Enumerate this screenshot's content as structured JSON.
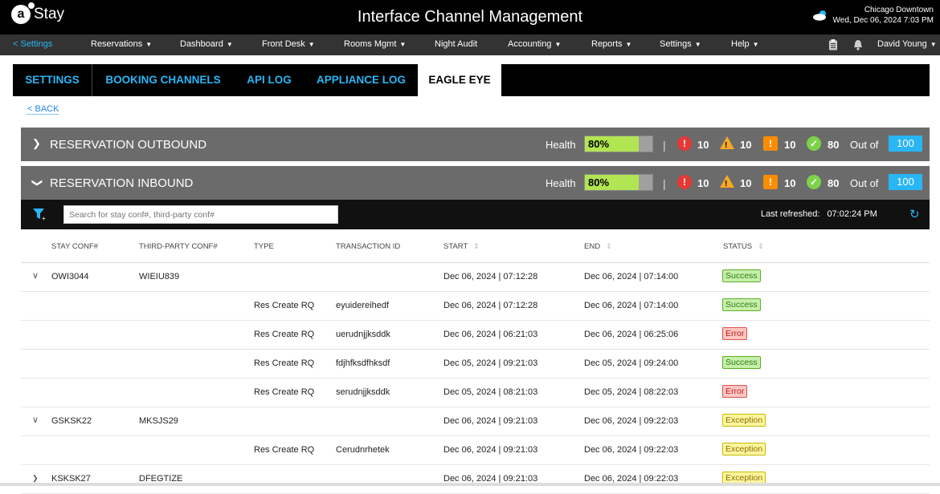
{
  "header": {
    "logo_letter": "a",
    "logo_text": "Stay",
    "title": "Interface Channel Management",
    "location": "Chicago Downtown",
    "datetime": "Wed, Dec 06, 2024 7:03 PM",
    "weather_icon": "cloud-icon"
  },
  "menu": {
    "back": "< Settings",
    "items": [
      {
        "label": "Reservations",
        "dropdown": true
      },
      {
        "label": "Dashboard",
        "dropdown": true
      },
      {
        "label": "Front Desk",
        "dropdown": true
      },
      {
        "label": "Rooms Mgmt",
        "dropdown": true
      },
      {
        "label": "Night Audit",
        "dropdown": false
      },
      {
        "label": "Accounting",
        "dropdown": true
      },
      {
        "label": "Reports",
        "dropdown": true
      },
      {
        "label": "Settings",
        "dropdown": true
      },
      {
        "label": "Help",
        "dropdown": true
      }
    ],
    "user": "David Young"
  },
  "tabs": [
    "SETTINGS",
    "BOOKING CHANNELS",
    "API LOG",
    "APPLIANCE LOG",
    "EAGLE EYE"
  ],
  "active_tab": "EAGLE EYE",
  "back_link": "< BACK",
  "sections": [
    {
      "title": "RESERVATION OUTBOUND",
      "expanded": false,
      "health_label": "Health",
      "health": "80%",
      "health_value": 0.8,
      "errors": "10",
      "warnings": "10",
      "alerts": "10",
      "success": "80",
      "out_of_label": "Out of",
      "total": "100"
    },
    {
      "title": "RESERVATION INBOUND",
      "expanded": true,
      "health_label": "Health",
      "health": "80%",
      "health_value": 0.8,
      "errors": "10",
      "warnings": "10",
      "alerts": "10",
      "success": "80",
      "out_of_label": "Out of",
      "total": "100"
    }
  ],
  "filter": {
    "search_placeholder": "Search for stay conf#, third-party conf#",
    "refreshed_label": "Last refreshed:",
    "refreshed_time": "07:02:24 PM"
  },
  "table": {
    "columns": [
      "STAY CONF#",
      "THIRD-PARTY CONF#",
      "TYPE",
      "TRANSACTION ID",
      "START",
      "END",
      "STATUS"
    ],
    "rows": [
      {
        "expand": "down",
        "stay": "OWI3044",
        "third": "WIEIU839",
        "type": "",
        "txn": "",
        "start": "Dec 06, 2024 | 07:12:28",
        "end": "Dec 06, 2024 | 07:14:00",
        "status": "Success"
      },
      {
        "expand": "",
        "stay": "",
        "third": "",
        "type": "Res Create RQ",
        "txn": "eyuidereihedf",
        "start": "Dec 06, 2024 | 07:12:28",
        "end": "Dec 06, 2024 | 07:14:00",
        "status": "Success"
      },
      {
        "expand": "",
        "stay": "",
        "third": "",
        "type": "Res Create RQ",
        "txn": "uerudnjjksddk",
        "start": "Dec 06, 2024 | 06:21:03",
        "end": "Dec 06, 2024 | 06:25:06",
        "status": "Error"
      },
      {
        "expand": "",
        "stay": "",
        "third": "",
        "type": "Res Create RQ",
        "txn": "fdjhfksdfhksdf",
        "start": "Dec 05, 2024 | 09:21:03",
        "end": "Dec 05, 2024 | 09:24:00",
        "status": "Success"
      },
      {
        "expand": "",
        "stay": "",
        "third": "",
        "type": "Res Create RQ",
        "txn": "serudnjjksddk",
        "start": "Dec 05, 2024 | 08:21:03",
        "end": "Dec 05, 2024 | 08:22:03",
        "status": "Error"
      },
      {
        "expand": "down",
        "stay": "GSKSK22",
        "third": "MKSJS29",
        "type": "",
        "txn": "",
        "start": "Dec 06, 2024 | 09:21:03",
        "end": "Dec 06, 2024 | 09:22:03",
        "status": "Exception"
      },
      {
        "expand": "",
        "stay": "",
        "third": "",
        "type": "Res Create RQ",
        "txn": "Cerudnrhetek",
        "start": "Dec 06, 2024 | 09:21:03",
        "end": "Dec 06, 2024 | 09:22:03",
        "status": "Exception"
      },
      {
        "expand": "right",
        "stay": "KSKSK27",
        "third": "DFEGTIZE",
        "type": "",
        "txn": "",
        "start": "Dec 06, 2024 | 09:21:03",
        "end": "Dec 06, 2024 | 09:22:03",
        "status": "Exception"
      }
    ]
  },
  "colors": {
    "accent": "#29b6f6",
    "topbar": "#000000",
    "menubar": "#333333",
    "section": "#6b6b6b",
    "health": "#b2e552",
    "error": "#e53935",
    "warning": "#f9a825",
    "alert": "#fb8c00",
    "success": "#7cd34a"
  }
}
